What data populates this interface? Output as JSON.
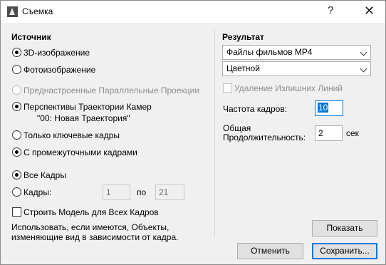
{
  "window": {
    "title": "Съемка",
    "help_glyph": "?",
    "close_glyph": "✕"
  },
  "source": {
    "title": "Источник",
    "options": {
      "d3": "3D-изображение",
      "photo": "Фотоизображение",
      "parallel": "Преднастроенные Параллельные Проекции",
      "camera": "Перспективы Траектории Камер",
      "camera_path": "\"00: Новая Траектория\"",
      "keyframes": "Только ключевые кадры",
      "interframes": "С промежуточными кадрами"
    },
    "frames": {
      "all": "Все Кадры",
      "range": "Кадры:",
      "from": "1",
      "to_label": "по",
      "to": "21"
    },
    "build_model": "Строить Модель для Всех Кадров",
    "note_line1": "Использовать, если имеются, Объекты,",
    "note_line2": "изменяющие вид в зависимости от кадра."
  },
  "result": {
    "title": "Результат",
    "format": "Файлы фильмов MP4",
    "color": "Цветной",
    "remove_lines": "Удаление Излишних Линий",
    "fps_label": "Частота кадров:",
    "fps_value": "10",
    "duration_label1": "Общая",
    "duration_label2": "Продолжительность:",
    "duration_value": "2",
    "duration_unit": "сек"
  },
  "buttons": {
    "show": "Показать",
    "cancel": "Отменить",
    "save": "Сохранить..."
  }
}
